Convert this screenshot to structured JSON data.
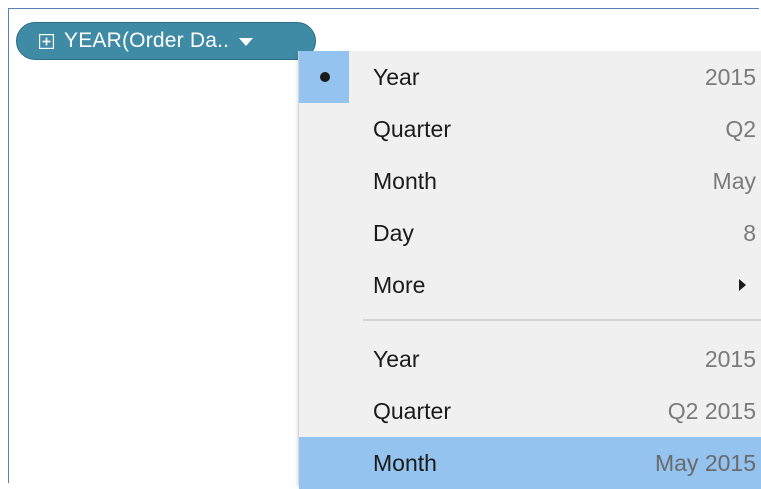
{
  "pill": {
    "label": "YEAR(Order Da..",
    "color": "#3f8aa5"
  },
  "menu": {
    "group1": [
      {
        "label": "Year",
        "value": "2015",
        "selected": true
      },
      {
        "label": "Quarter",
        "value": "Q2"
      },
      {
        "label": "Month",
        "value": "May"
      },
      {
        "label": "Day",
        "value": "8"
      },
      {
        "label": "More",
        "value": "",
        "submenu": true
      }
    ],
    "group2": [
      {
        "label": "Year",
        "value": "2015"
      },
      {
        "label": "Quarter",
        "value": "Q2 2015"
      },
      {
        "label": "Month",
        "value": "May 2015",
        "highlighted": true
      }
    ],
    "highlight_color": "#93c3ee"
  }
}
